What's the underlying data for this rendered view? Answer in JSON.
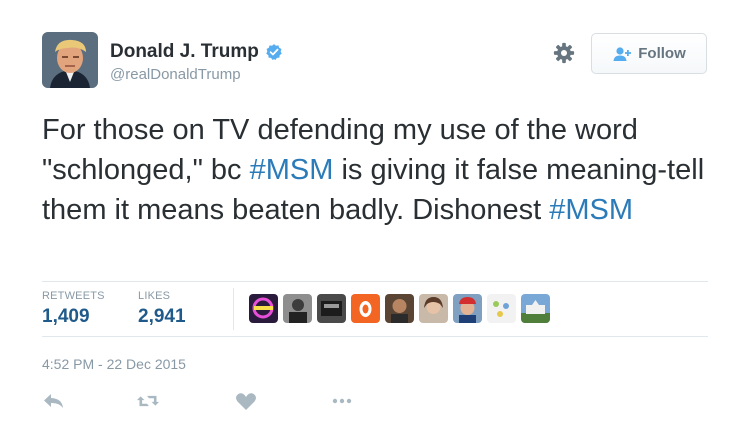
{
  "user": {
    "name": "Donald J. Trump",
    "handle": "@realDonaldTrump",
    "verified": true
  },
  "header": {
    "follow_label": "Follow"
  },
  "tweet": {
    "segments": [
      {
        "text": "For those on TV defending my use of the word \"schlonged,\" bc ",
        "hashtag": false
      },
      {
        "text": "#MSM",
        "hashtag": true
      },
      {
        "text": " is giving it false meaning-tell them it means beaten badly. Dishonest ",
        "hashtag": false
      },
      {
        "text": "#MSM",
        "hashtag": true
      }
    ]
  },
  "stats": {
    "retweets_label": "RETWEETS",
    "retweets_value": "1,409",
    "likes_label": "LIKES",
    "likes_value": "2,941"
  },
  "likers_count": 9,
  "timestamp": "4:52 PM - 22 Dec 2015",
  "actions": [
    "reply-icon",
    "retweet-icon",
    "like-icon",
    "more-icon"
  ],
  "colors": {
    "hashtag": "#2b7bb9",
    "stat_value": "#1f5a8a",
    "verified": "#55acee",
    "muted": "#8899a6"
  }
}
